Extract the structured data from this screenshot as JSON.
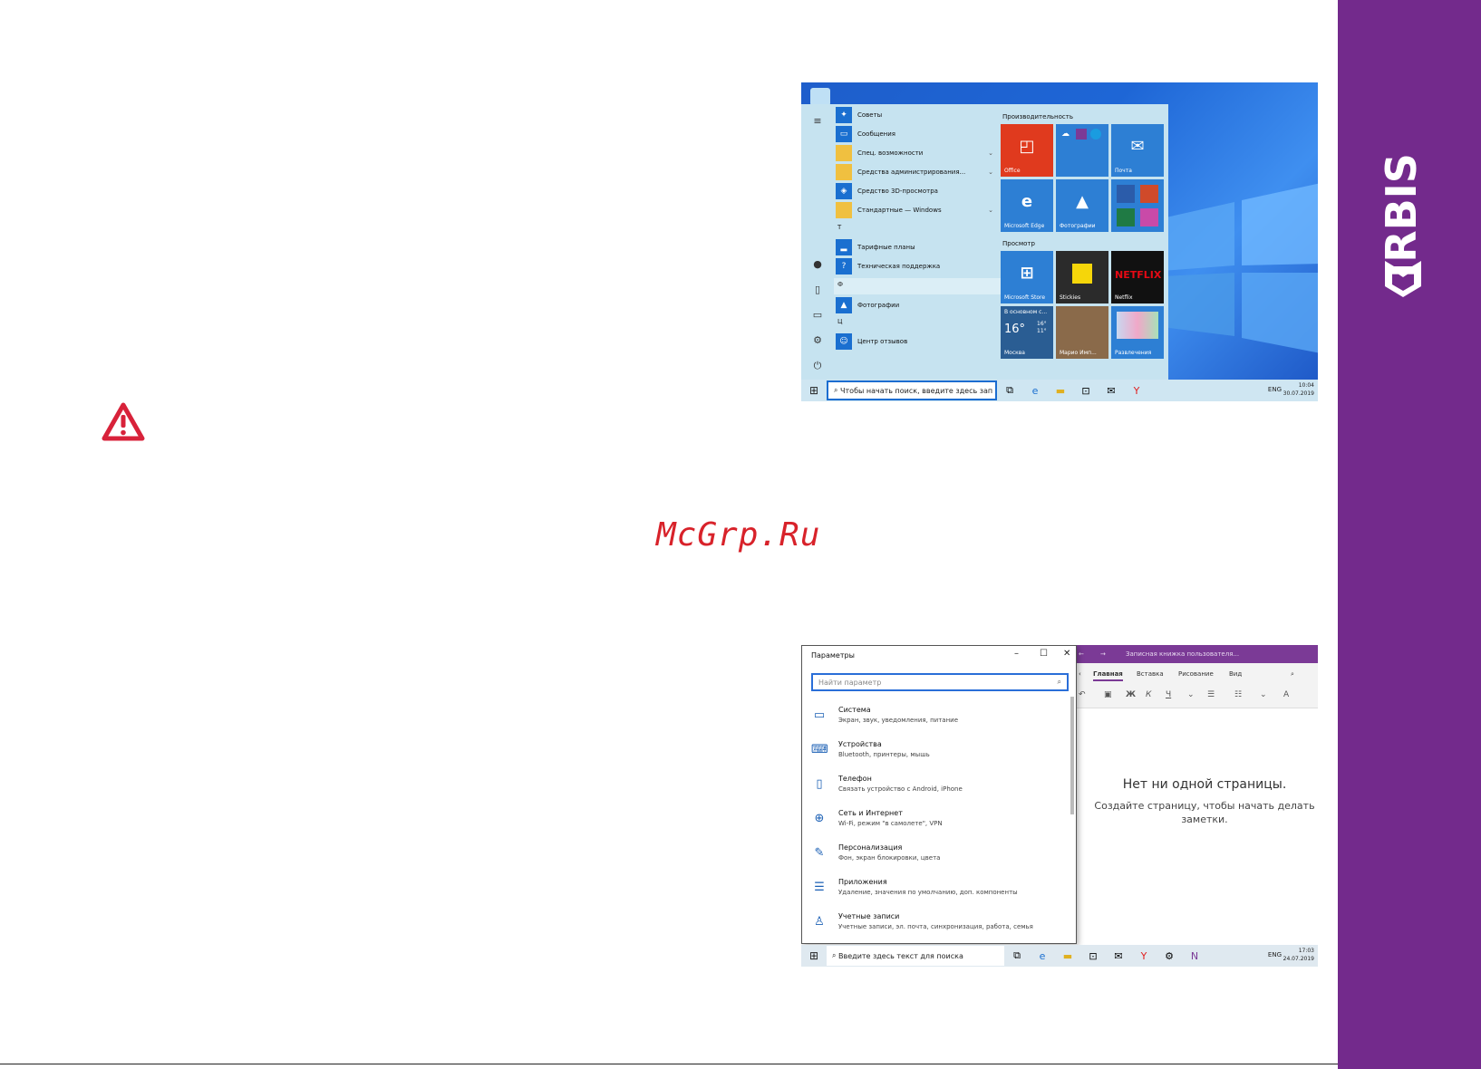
{
  "brand": {
    "name": "IRBIS",
    "reg": "®",
    "band_color": "#732a8c"
  },
  "watermark": "McGrp.Ru",
  "start_menu": {
    "apps": [
      {
        "label": "Советы",
        "icon": "lightbulb-icon",
        "color": "#1a6fd0"
      },
      {
        "label": "Сообщения",
        "icon": "chat-icon",
        "color": "#1a6fd0"
      },
      {
        "label": "Спец. возможности",
        "icon": "folder-icon",
        "color": "#f0c040",
        "expandable": true
      },
      {
        "label": "Средства администрирования...",
        "icon": "folder-icon",
        "color": "#f0c040",
        "expandable": true
      },
      {
        "label": "Средство 3D-просмотра",
        "icon": "cube-icon",
        "color": "#1a6fd0"
      },
      {
        "label": "Стандартные — Windows",
        "icon": "folder-icon",
        "color": "#f0c040",
        "expandable": true
      }
    ],
    "letter_t": "Т",
    "apps_t": [
      {
        "label": "Тарифные планы",
        "icon": "signal-icon",
        "color": "#1a6fd0"
      },
      {
        "label": "Техническая поддержка",
        "icon": "help-icon",
        "color": "#1a6fd0"
      }
    ],
    "letter_f": "Ф",
    "apps_f": [
      {
        "label": "Фотографии",
        "icon": "photo-icon",
        "color": "#1a6fd0"
      }
    ],
    "letter_c": "Ц",
    "apps_c": [
      {
        "label": "Центр отзывов",
        "icon": "feedback-icon",
        "color": "#1a6fd0"
      }
    ],
    "group_productivity": "Производительность",
    "group_browse": "Просмотр",
    "tiles": {
      "office": "Office",
      "mail": "Почта",
      "edge": "Microsoft Edge",
      "photos": "Фотографии",
      "store": "Microsoft Store",
      "stickies": "Stickies",
      "netflix": "Netflix",
      "netflix_logo": "NETFLIX",
      "weather_header": "В основном с...",
      "weather_temp": "16°",
      "weather_hi": "16°",
      "weather_lo": "11°",
      "weather_city": "Москва",
      "game": "Марио Имп...",
      "play": "Развлечения"
    },
    "taskbar_search": "Чтобы начать поиск, введите здесь зап",
    "tray_lang": "ENG",
    "tray_time": "10:04",
    "tray_date": "30.07.2019"
  },
  "settings_window": {
    "title": "Параметры",
    "search_placeholder": "Найти параметр",
    "items": [
      {
        "title": "Система",
        "desc": "Экран, звук, уведомления, питание",
        "icon": "laptop-icon"
      },
      {
        "title": "Устройства",
        "desc": "Bluetooth, принтеры, мышь",
        "icon": "devices-icon"
      },
      {
        "title": "Телефон",
        "desc": "Связать устройство с Android, iPhone",
        "icon": "phone-icon"
      },
      {
        "title": "Сеть и Интернет",
        "desc": "Wi-Fi, режим \"в самолете\", VPN",
        "icon": "globe-icon"
      },
      {
        "title": "Персонализация",
        "desc": "Фон, экран блокировки, цвета",
        "icon": "brush-icon"
      },
      {
        "title": "Приложения",
        "desc": "Удаление, значения по умолчанию, доп. компоненты",
        "icon": "apps-list-icon"
      },
      {
        "title": "Учетные записи",
        "desc": "Учетные записи, эл. почта, синхронизация, работа, семья",
        "icon": "person-icon"
      }
    ]
  },
  "onenote": {
    "title": "Записная книжка пользователя...",
    "tabs": [
      "Главная",
      "Вставка",
      "Рисование",
      "Вид"
    ],
    "empty_title": "Нет ни одной страницы.",
    "empty_desc": "Создайте страницу, чтобы начать делать заметки."
  },
  "taskbar2": {
    "search": "Введите здесь текст для поиска",
    "tray_lang": "ENG",
    "tray_time": "17:03",
    "tray_date": "24.07.2019"
  }
}
